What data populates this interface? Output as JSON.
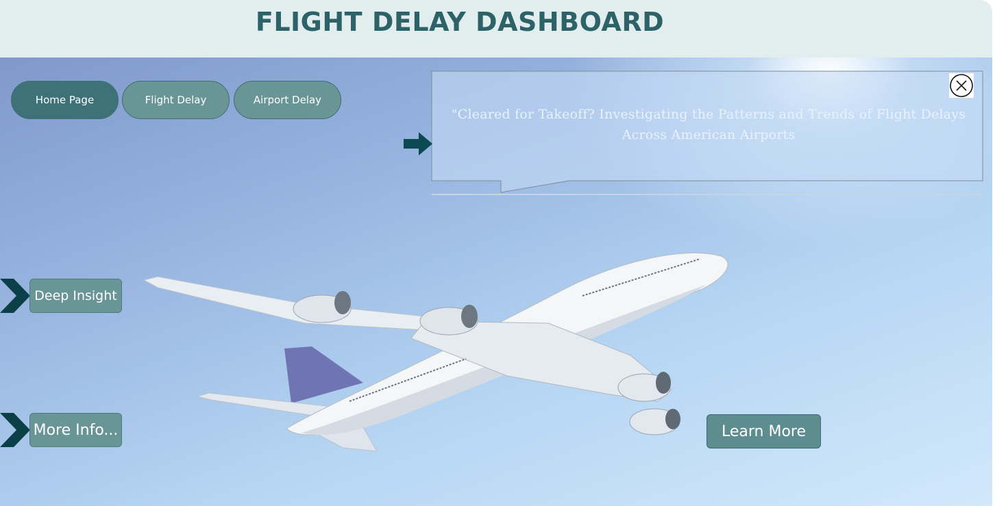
{
  "header": {
    "title": "FLIGHT DELAY DASHBOARD"
  },
  "nav": {
    "home_label": "Home Page",
    "flight_delay_label": "Flight Delay",
    "airport_delay_label": "Airport Delay"
  },
  "callout": {
    "text": "\"Cleared for Takeoff? Investigating the Patterns and Trends of Flight Delays Across American Airports"
  },
  "side_buttons": {
    "deep_insight_label": "Deep Insight",
    "more_info_label": "More Info..."
  },
  "learn_more_label": "Learn More",
  "icons": {
    "close": "close-icon",
    "pointer_arrow": "arrow-right-icon",
    "chevron": "chevron-right-icon"
  },
  "colors": {
    "header_bg": "#e2eeee",
    "title": "#2c6268",
    "button_active": "#3e7278",
    "button": "#6a9596",
    "chevron": "#0b4048"
  }
}
